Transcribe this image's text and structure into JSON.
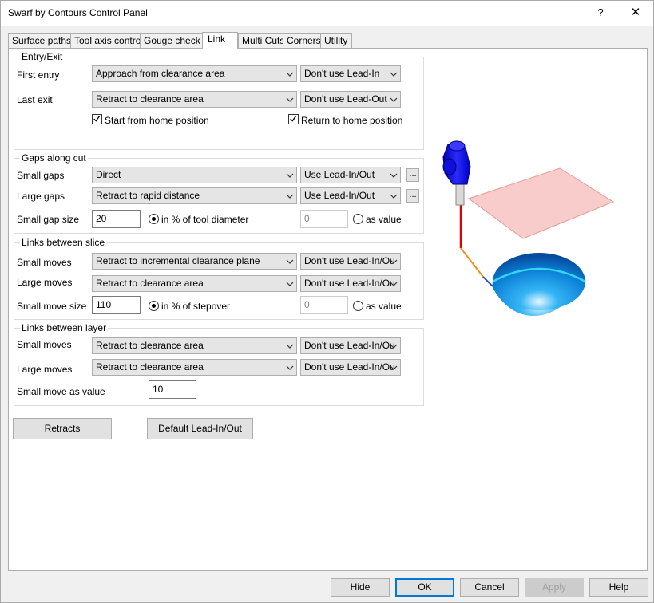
{
  "window": {
    "title": "Swarf by Contours Control Panel",
    "help_glyph": "?",
    "close_glyph": "✕"
  },
  "tabs": [
    {
      "label": "Surface paths",
      "active": false
    },
    {
      "label": "Tool axis control",
      "active": false
    },
    {
      "label": "Gouge check",
      "active": false
    },
    {
      "label": "Link",
      "active": true
    },
    {
      "label": "Multi Cuts",
      "active": false
    },
    {
      "label": "Corners",
      "active": false
    },
    {
      "label": "Utility",
      "active": false
    }
  ],
  "entry_exit": {
    "title": "Entry/Exit",
    "first_entry": {
      "label": "First entry",
      "mode": "Approach from clearance area",
      "lead": "Don't use Lead-In"
    },
    "last_exit": {
      "label": "Last exit",
      "mode": "Retract to clearance area",
      "lead": "Don't use Lead-Out"
    },
    "start_home": {
      "label": "Start from home position",
      "checked": true
    },
    "return_home": {
      "label": "Return to home position",
      "checked": true
    }
  },
  "gaps_along_cut": {
    "title": "Gaps along cut",
    "small_gaps": {
      "label": "Small gaps",
      "mode": "Direct",
      "lead": "Use Lead-In/Out",
      "more": "..."
    },
    "large_gaps": {
      "label": "Large gaps",
      "mode": "Retract to rapid distance",
      "lead": "Use Lead-In/Out",
      "more": "..."
    },
    "small_gap_size": {
      "label": "Small gap size",
      "value": "20",
      "option_percent": "in % of tool diameter",
      "value_disabled": "0",
      "option_value": "as value",
      "selected": "percent"
    }
  },
  "links_between_slice": {
    "title": "Links between slice",
    "small_moves": {
      "label": "Small moves",
      "mode": "Retract to incremental clearance plane",
      "lead": "Don't use Lead-In/Ou"
    },
    "large_moves": {
      "label": "Large moves",
      "mode": "Retract to clearance area",
      "lead": "Don't use Lead-In/Ou"
    },
    "small_move_size": {
      "label": "Small move size",
      "value": "110",
      "option_percent": "in % of stepover",
      "value_disabled": "0",
      "option_value": "as value",
      "selected": "percent"
    }
  },
  "links_between_layer": {
    "title": "Links between layer",
    "small_moves": {
      "label": "Small moves",
      "mode": "Retract to clearance area",
      "lead": "Don't use Lead-In/Ou"
    },
    "large_moves": {
      "label": "Large moves",
      "mode": "Retract to clearance area",
      "lead": "Don't use Lead-In/Ou"
    },
    "small_move_value": {
      "label": "Small move as value",
      "value": "10"
    }
  },
  "panel_buttons": {
    "retracts": "Retracts",
    "default_lead": "Default Lead-In/Out"
  },
  "footer": {
    "hide": "Hide",
    "ok": "OK",
    "cancel": "Cancel",
    "apply": "Apply",
    "help": "Help"
  },
  "colors": {
    "accent": "#0078d7",
    "tool_blue": "#1414e6",
    "plane_pink": "#f9c9c9",
    "bowl_blue": "#0a8fe0",
    "path_cyan": "#35d6f0"
  }
}
